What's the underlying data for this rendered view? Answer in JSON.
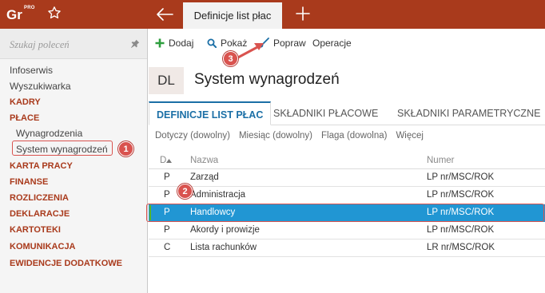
{
  "app": {
    "logo_text": "Gr",
    "logo_suffix": "PRO",
    "active_tab": "Definicje list płac"
  },
  "sidebar": {
    "search_placeholder": "Szukaj poleceń",
    "items": [
      {
        "label": "Infoserwis",
        "kind": "plain"
      },
      {
        "label": "Wyszukiwarka",
        "kind": "plain"
      },
      {
        "label": "KADRY",
        "kind": "section"
      },
      {
        "label": "PŁACE",
        "kind": "section"
      },
      {
        "label": "Wynagrodzenia",
        "kind": "sub"
      },
      {
        "label": "System wynagrodzeń",
        "kind": "sub",
        "highlighted": true
      },
      {
        "label": "KARTA PRACY",
        "kind": "section"
      },
      {
        "label": "FINANSE",
        "kind": "section"
      },
      {
        "label": "ROZLICZENIA",
        "kind": "section"
      },
      {
        "label": "DEKLARACJE",
        "kind": "section"
      },
      {
        "label": "KARTOTEKI",
        "kind": "section"
      },
      {
        "label": "KOMUNIKACJA",
        "kind": "section"
      },
      {
        "label": "EWIDENCJE DODATKOWE",
        "kind": "section"
      }
    ]
  },
  "toolbar": {
    "add_label": "Dodaj",
    "show_label": "Pokaż",
    "edit_label": "Popraw",
    "operations_label": "Operacje"
  },
  "page": {
    "badge": "DL",
    "title": "System wynagrodzeń"
  },
  "tabs": [
    "DEFINICJE LIST PŁAC",
    "SKŁADNIKI PŁACOWE",
    "SKŁADNIKI PARAMETRYCZNE"
  ],
  "filters": [
    "Dotyczy (dowolny)",
    "Miesiąc (dowolny)",
    "Flaga (dowolna)",
    "Więcej"
  ],
  "table": {
    "columns": [
      "D",
      "Nazwa",
      "Numer"
    ],
    "rows": [
      {
        "d": "P",
        "name": "Zarząd",
        "number": "LP nr/MSC/ROK"
      },
      {
        "d": "P",
        "name": "Administracja",
        "number": "LP nr/MSC/ROK"
      },
      {
        "d": "P",
        "name": "Handlowcy",
        "number": "LP nr/MSC/ROK",
        "selected": true
      },
      {
        "d": "P",
        "name": "Akordy i prowizje",
        "number": "LP nr/MSC/ROK"
      },
      {
        "d": "C",
        "name": "Lista rachunków",
        "number": "LR nr/MSC/ROK"
      }
    ]
  },
  "callouts": [
    "1",
    "2",
    "3"
  ],
  "colors": {
    "brand": "#a93a1c",
    "accent": "#1b6fa6",
    "selection": "#2196d3",
    "callout": "#d9534f",
    "add_icon": "#2e9e3e"
  },
  "icons": [
    "star-icon",
    "back-arrow-icon",
    "plus-icon",
    "pin-icon",
    "add-icon",
    "search-icon",
    "brush-icon",
    "sort-up-icon"
  ]
}
